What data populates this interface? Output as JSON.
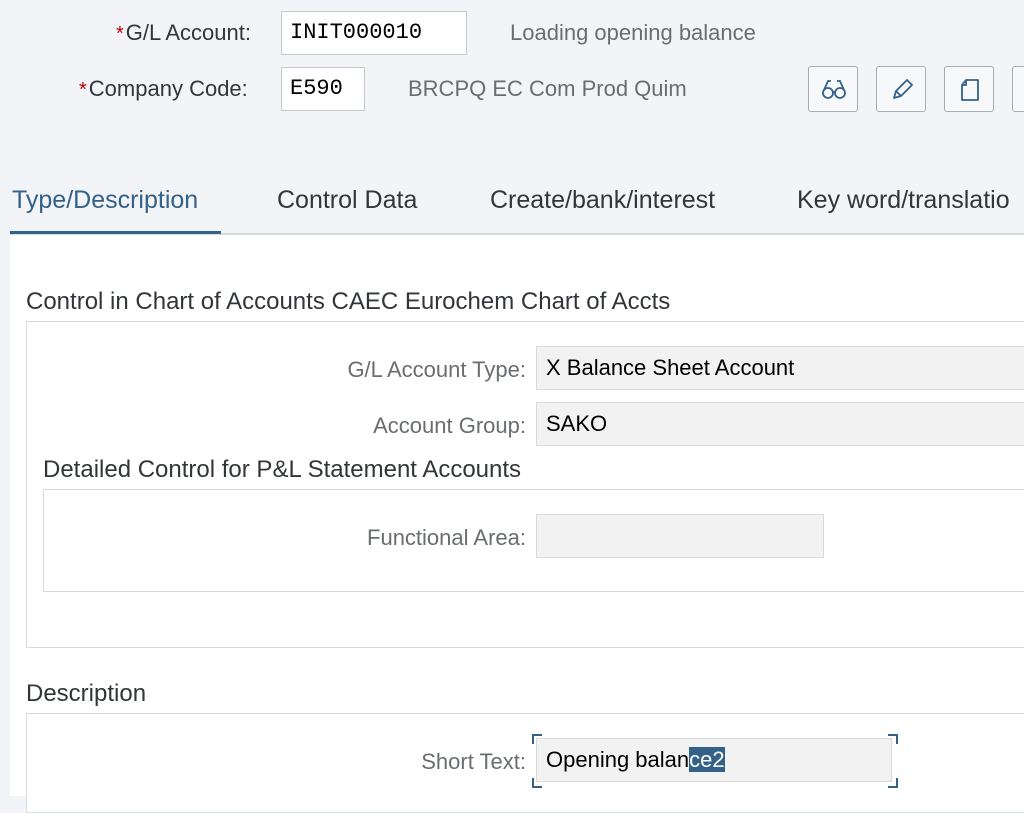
{
  "header": {
    "gl_account": {
      "label": "G/L Account:",
      "required_marker": "*",
      "value": "INIT000010",
      "description": "Loading opening balance"
    },
    "company_code": {
      "label": "Company Code:",
      "required_marker": "*",
      "value": "E590",
      "description": "BRCPQ EC Com Prod Quim"
    },
    "toolbar": {
      "buttons": [
        {
          "icon": "glasses-icon"
        },
        {
          "icon": "pencil-icon"
        },
        {
          "icon": "document-icon"
        }
      ]
    }
  },
  "tabs": [
    {
      "label": "Type/Description",
      "active": true
    },
    {
      "label": "Control Data",
      "active": false
    },
    {
      "label": "Create/bank/interest",
      "active": false
    },
    {
      "label": "Key word/translatio",
      "active": false
    }
  ],
  "control_section": {
    "title": "Control in Chart of Accounts CAEC Eurochem Chart of Accts",
    "gl_account_type": {
      "label": "G/L Account Type:",
      "value": "X Balance Sheet Account"
    },
    "account_group": {
      "label": "Account Group:",
      "value": "SAKO"
    },
    "pl_subsection": {
      "title": "Detailed Control for P&L Statement Accounts",
      "functional_area": {
        "label": "Functional Area:",
        "value": ""
      }
    }
  },
  "description_section": {
    "title": "Description",
    "short_text": {
      "label": "Short Text:",
      "value_unselected": "Opening balan",
      "value_selected": "ce2"
    }
  },
  "colors": {
    "accent": "#346187",
    "required": "#bb0000",
    "background": "#f2f4f7"
  }
}
